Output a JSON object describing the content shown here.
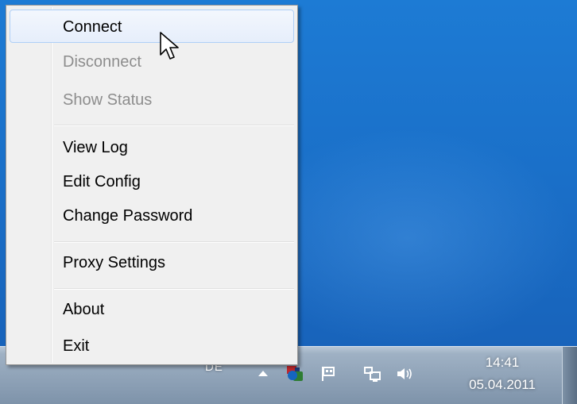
{
  "menu": {
    "items": [
      {
        "label": "Connect",
        "enabled": true,
        "highlighted": true
      },
      {
        "label": "Disconnect",
        "enabled": false
      },
      {
        "label": "Show Status",
        "enabled": false
      },
      {
        "label": "View Log",
        "enabled": true
      },
      {
        "label": "Edit Config",
        "enabled": true
      },
      {
        "label": "Change Password",
        "enabled": true
      },
      {
        "label": "Proxy Settings",
        "enabled": true
      },
      {
        "label": "About",
        "enabled": true
      },
      {
        "label": "Exit",
        "enabled": true
      }
    ]
  },
  "taskbar": {
    "language": "DE",
    "tray_icons": [
      "show-hidden-icons-arrow",
      "openvpn-icon",
      "action-center-flag-icon",
      "network-icon",
      "volume-icon"
    ],
    "clock": {
      "time": "14:41",
      "date": "05.04.2011"
    }
  },
  "colors": {
    "desktop": "#1a6fc8",
    "menu_background": "#f0f0f0",
    "highlight_border": "#aecff7",
    "disabled_text": "#8d8d8d"
  }
}
